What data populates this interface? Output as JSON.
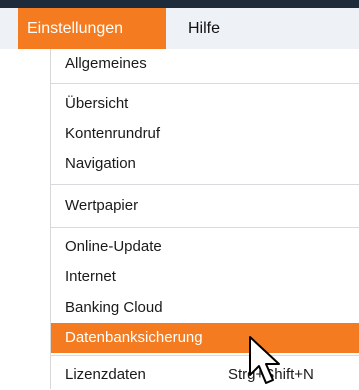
{
  "menubar": {
    "items": [
      {
        "label": "Einstellungen",
        "active": true
      },
      {
        "label": "Hilfe",
        "active": false
      }
    ]
  },
  "menu": {
    "items": [
      {
        "label": "Allgemeines"
      },
      {
        "label": "Übersicht"
      },
      {
        "label": "Kontenrundruf"
      },
      {
        "label": "Navigation"
      },
      {
        "label": "Wertpapier"
      },
      {
        "label": "Online-Update"
      },
      {
        "label": "Internet"
      },
      {
        "label": "Banking Cloud"
      },
      {
        "label": "Datenbanksicherung",
        "highlighted": true
      },
      {
        "label": "Lizenzdaten",
        "shortcut": "Strg+Shift+N"
      }
    ]
  },
  "colors": {
    "accent": "#f47b20",
    "topbar": "#1e2b3a",
    "menubar_bg": "#eef1f5"
  },
  "pointer": {
    "icon": "mouse-pointer-icon"
  }
}
